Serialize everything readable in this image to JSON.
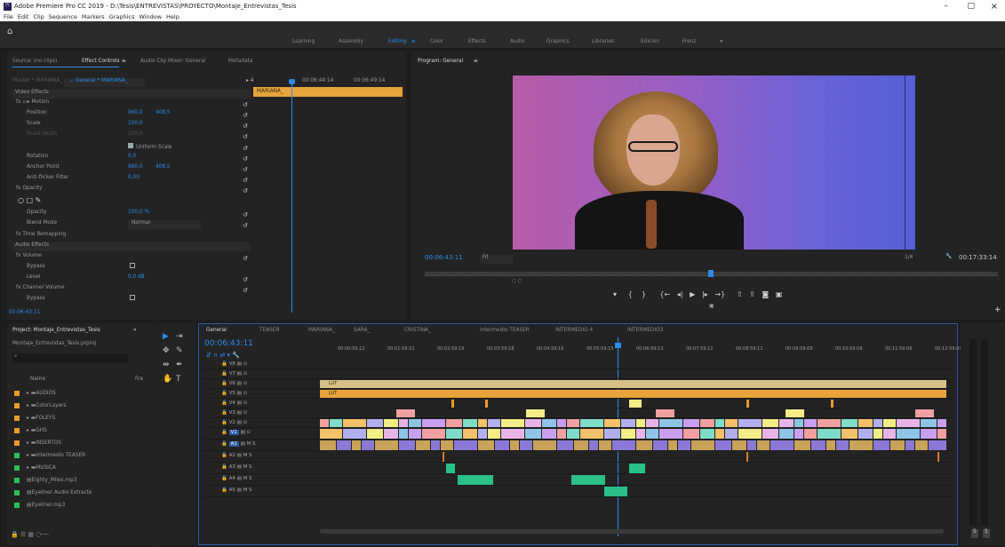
{
  "window": {
    "title": "Adobe Premiere Pro CC 2019 - D:\\Tesis\\ENTREVISTAS\\PROYECTO\\Montaje_Entrevistas_Tesis",
    "min": "–",
    "max": "▢",
    "close": "×"
  },
  "menu": [
    "File",
    "Edit",
    "Clip",
    "Sequence",
    "Markers",
    "Graphics",
    "Window",
    "Help"
  ],
  "workspaces": [
    "Learning",
    "Assembly",
    "Editing",
    "Color",
    "Effects",
    "Audio",
    "Graphics",
    "Libraries",
    "Edición",
    "Frenz",
    "»"
  ],
  "active_workspace": "Editing",
  "source_panel": {
    "tabs": [
      "Source: (no clips)",
      "Effect Controls",
      "Audio Clip Mixer: General",
      "Metadata"
    ],
    "master": "Master * MARIANA_",
    "seq": "General * MARIANA_",
    "tc1": "00:06:44:14",
    "tc2": "00:06:49:14",
    "clip_label": "MARIANA_",
    "video_effects": "Video Effects",
    "rows": [
      {
        "label": "fx  ▭▸ Motion",
        "v1": "",
        "v2": ""
      },
      {
        "label": "Position",
        "v1": "960,0",
        "v2": "408,5"
      },
      {
        "label": "Scale",
        "v1": "100,0",
        "v2": ""
      },
      {
        "label": "Scale Width",
        "v1": "100,0",
        "v2": ""
      },
      {
        "label": "Uniform Scale",
        "v1": "",
        "v2": ""
      },
      {
        "label": "Rotation",
        "v1": "0,0",
        "v2": ""
      },
      {
        "label": "Anchor Point",
        "v1": "960,0",
        "v2": "408,5"
      },
      {
        "label": "Anti-flicker Filter",
        "v1": "0,00",
        "v2": ""
      },
      {
        "label": "fx  Opacity",
        "v1": "",
        "v2": ""
      },
      {
        "label": "Opacity",
        "v1": "100,0 %",
        "v2": ""
      },
      {
        "label": "Blend Mode",
        "v1": "Normal",
        "v2": ""
      },
      {
        "label": "fx  Time Remapping",
        "v1": "",
        "v2": ""
      }
    ],
    "audio_effects": "Audio Effects",
    "arows": [
      {
        "label": "fx  Volume",
        "v1": ""
      },
      {
        "label": "Bypass",
        "v1": ""
      },
      {
        "label": "Level",
        "v1": "0,0 dB"
      },
      {
        "label": "fx  Channel Volume",
        "v1": ""
      },
      {
        "label": "Bypass",
        "v1": ""
      }
    ],
    "bottom_tc": "00:06:43:11"
  },
  "program": {
    "tab": "Program: General",
    "tc": "00:06:43:11",
    "fit": "Fit",
    "ratio": "1/4",
    "duration": "00:17:33:14"
  },
  "project": {
    "tab": "Project: Montaje_Entrevistas_Tesis",
    "file": "Montaje_Entrevistas_Tesis.prproj",
    "col_name": "Name",
    "col_fr": "Fra",
    "items": [
      {
        "name": "AUDIOS",
        "color": "#e89a2b"
      },
      {
        "name": "ColorLayers",
        "color": "#e89a2b"
      },
      {
        "name": "FOLEYS",
        "color": "#e89a2b"
      },
      {
        "name": "GHS",
        "color": "#e89a2b"
      },
      {
        "name": "INSERTOS",
        "color": "#e89a2b"
      },
      {
        "name": "Intermedio TEASER",
        "color": "#2bbf5a"
      },
      {
        "name": "MUSICA",
        "color": "#2bbf5a"
      },
      {
        "name": "Eighty_Miles.mp3",
        "color": "#2bbf5a"
      },
      {
        "name": "Eyeliner Audio Extracte",
        "color": "#2bbf5a"
      },
      {
        "name": "Eyeliner.mp3",
        "color": "#2bbf5a"
      }
    ]
  },
  "timeline": {
    "tabs": [
      "General",
      "TEASER",
      "MARIANA_",
      "SARA_",
      "CRISTINA_",
      "intermedio TEASER",
      "INTERMEDIO 4",
      "INTERMEDIO3"
    ],
    "tc": "00:06:43:11",
    "ruler": [
      "00:00:59:22",
      "00:01:59:21",
      "00:02:59:19",
      "00:03:59:18",
      "00:04:59:16",
      "00:05:59:15",
      "00:06:59:13",
      "00:07:59:12",
      "00:08:59:11",
      "00:09:59:09",
      "00:10:59:08",
      "00:11:59:06",
      "00:12:59:05"
    ],
    "tracks": [
      "V8",
      "V7",
      "V6",
      "V5",
      "V4",
      "V3",
      "V2",
      "V1",
      "A1",
      "A2",
      "A3",
      "A4",
      "A5"
    ],
    "lut": "LUT"
  },
  "meters": [
    "S",
    "S"
  ]
}
